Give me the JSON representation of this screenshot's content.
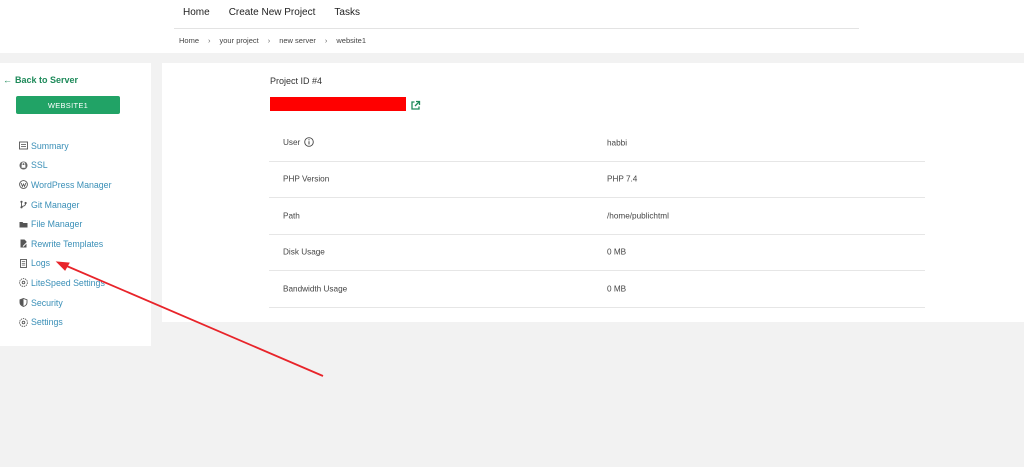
{
  "topnav": {
    "items": [
      "Home",
      "Create New Project",
      "Tasks"
    ]
  },
  "breadcrumb": [
    "Home",
    "your project",
    "new server",
    "website1"
  ],
  "sidebar": {
    "back_label": "Back to Server",
    "site_name": "WEBSITE1",
    "items": [
      {
        "label": "Summary",
        "icon": "list-icon"
      },
      {
        "label": "SSL",
        "icon": "lock-icon"
      },
      {
        "label": "WordPress Manager",
        "icon": "wordpress-icon"
      },
      {
        "label": "Git Manager",
        "icon": "git-branch-icon"
      },
      {
        "label": "File Manager",
        "icon": "folder-icon"
      },
      {
        "label": "Rewrite Templates",
        "icon": "file-edit-icon"
      },
      {
        "label": "Logs",
        "icon": "document-icon"
      },
      {
        "label": "LiteSpeed Settings",
        "icon": "gear-icon"
      },
      {
        "label": "Security",
        "icon": "shield-icon"
      },
      {
        "label": "Settings",
        "icon": "gear-icon"
      }
    ]
  },
  "main": {
    "project_id": "Project ID #4",
    "rows": [
      {
        "label": "User",
        "value": "habbi",
        "has_info_icon": true
      },
      {
        "label": "PHP Version",
        "value": "PHP 7.4"
      },
      {
        "label": "Path",
        "value": "/home/publichtml"
      },
      {
        "label": "Disk Usage",
        "value": "0 MB"
      },
      {
        "label": "Bandwidth Usage",
        "value": "0 MB"
      }
    ]
  },
  "colors": {
    "accent_green": "#21a366",
    "link_blue": "#3a8fb7",
    "redaction_red": "#ff0000",
    "annotation_arrow": "#e8242a"
  }
}
